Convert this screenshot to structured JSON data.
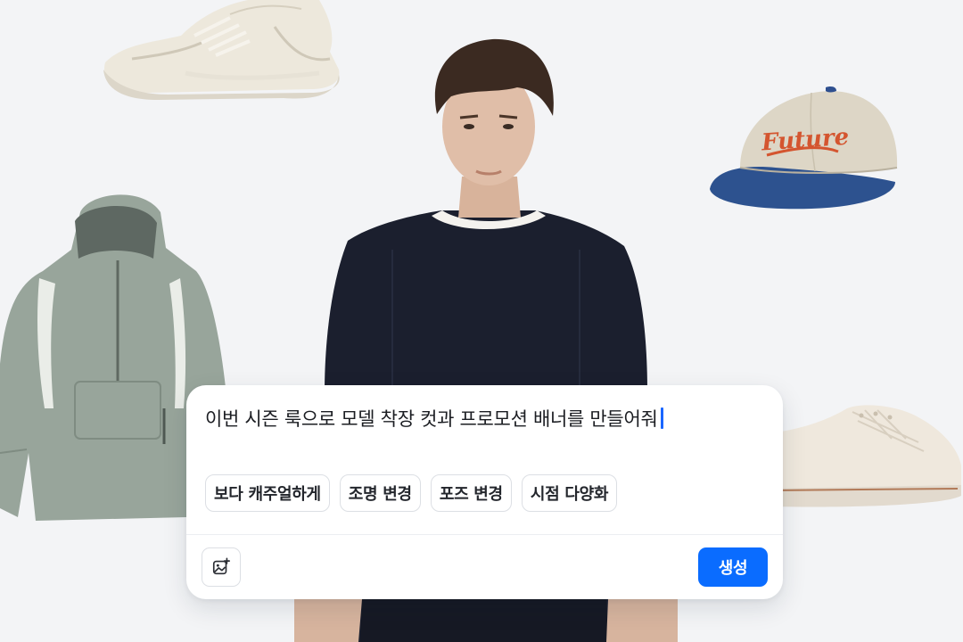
{
  "prompt": {
    "text": "이번 시즌 룩으로 모델 착장 컷과 프로모션 배너를 만들어줘",
    "caret_color": "#1a66ff"
  },
  "suggestions": [
    {
      "label": "보다 캐주얼하게"
    },
    {
      "label": "조명 변경"
    },
    {
      "label": "포즈 변경"
    },
    {
      "label": "시점 다양화"
    }
  ],
  "toolbar": {
    "attach_icon": "image-add-icon",
    "generate_label": "생성",
    "generate_color": "#0a6cff"
  },
  "products": {
    "cap_text": "Future"
  },
  "colors": {
    "background": "#f3f4f6",
    "card": "#ffffff"
  }
}
